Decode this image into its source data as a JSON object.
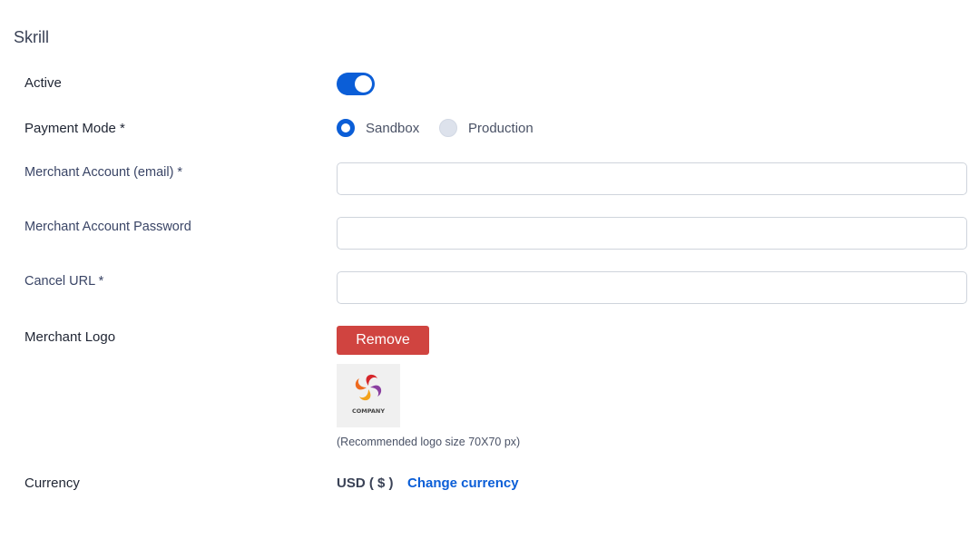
{
  "section": {
    "title": "Skrill"
  },
  "active": {
    "label": "Active",
    "on": true,
    "accent": "#0b5ed7"
  },
  "payment_mode": {
    "label": "Payment Mode *",
    "options": [
      {
        "label": "Sandbox",
        "selected": true
      },
      {
        "label": "Production",
        "selected": false
      }
    ]
  },
  "merchant_email": {
    "label": "Merchant Account (email) *",
    "value": ""
  },
  "merchant_password": {
    "label": "Merchant Account Password",
    "value": ""
  },
  "cancel_url": {
    "label": "Cancel URL *",
    "value": ""
  },
  "merchant_logo": {
    "label": "Merchant Logo",
    "remove_label": "Remove",
    "remove_color": "#d04440",
    "logo_text": "COMPANY",
    "hint": "(Recommended logo size 70X70 px)"
  },
  "currency": {
    "label": "Currency",
    "value": "USD ( $ )",
    "change_label": "Change currency",
    "link_color": "#0b5ed7"
  }
}
